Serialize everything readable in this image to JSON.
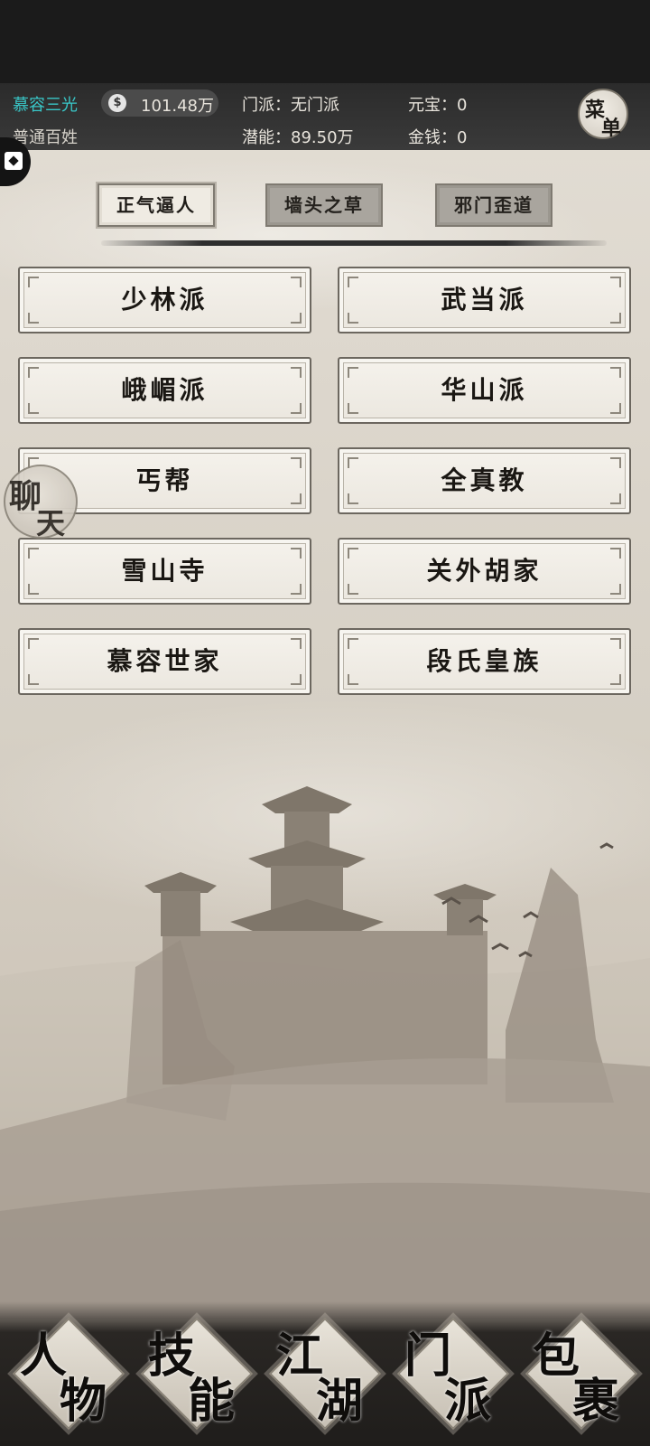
{
  "player": {
    "name": "慕容三光",
    "rank": "普通百姓",
    "coin_value": "101.48万",
    "sect": "门派：无门派",
    "potential": "潜能：89.50万",
    "yuanbao": "元宝：0",
    "money": "金钱：0"
  },
  "menu": {
    "char1": "菜",
    "char2": "单"
  },
  "chat": {
    "char1": "聊",
    "char2": "天"
  },
  "filter_tabs": [
    {
      "label": "正气逼人",
      "active": true
    },
    {
      "label": "墙头之草",
      "active": false
    },
    {
      "label": "邪门歪道",
      "active": false
    }
  ],
  "sects": [
    "少林派",
    "武当派",
    "峨嵋派",
    "华山派",
    "丐帮",
    "全真教",
    "雪山寺",
    "关外胡家",
    "慕容世家",
    "段氏皇族"
  ],
  "bottom_nav": [
    {
      "c1": "人",
      "c2": "物"
    },
    {
      "c1": "技",
      "c2": "能"
    },
    {
      "c1": "江",
      "c2": "湖"
    },
    {
      "c1": "门",
      "c2": "派"
    },
    {
      "c1": "包",
      "c2": "裹"
    }
  ],
  "icons": {
    "coin": "coin-icon",
    "side_tab": "puzzle-icon"
  },
  "colors": {
    "player_name": "#39c7c8",
    "top_bar": "#333333"
  }
}
